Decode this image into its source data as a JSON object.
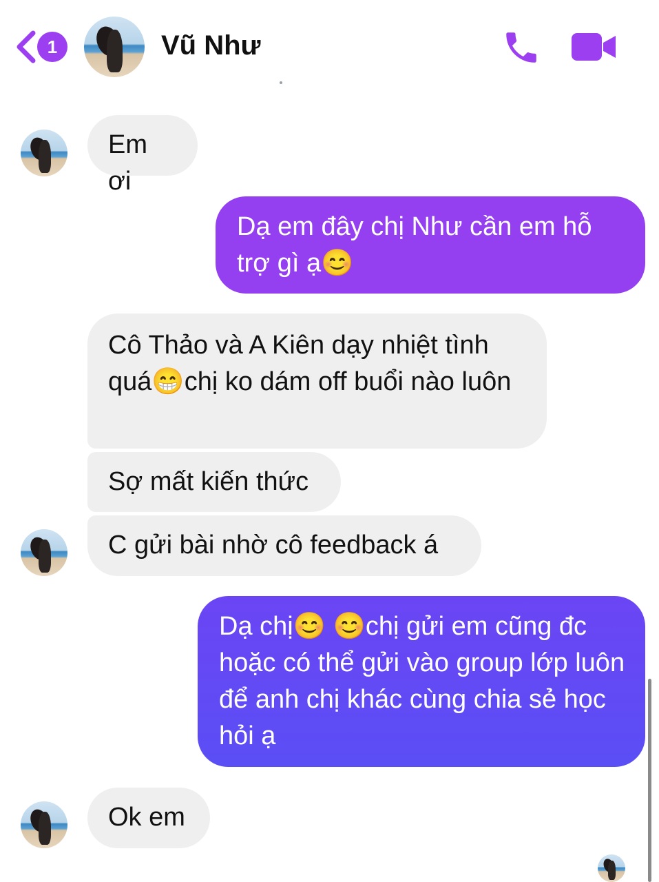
{
  "header": {
    "back_icon": "chevron-left-icon",
    "unread_count": "1",
    "contact_name": "Vũ Như",
    "call_icon": "phone-icon",
    "video_icon": "video-camera-icon",
    "accent_color": "#9b3ff0"
  },
  "messages": [
    {
      "sender": "contact",
      "text": "Em ơi"
    },
    {
      "sender": "me",
      "text": "Dạ em đây chị Như cần em hỗ trợ gì ạ😊"
    },
    {
      "sender": "contact",
      "text": "Cô Thảo và A Kiên dạy nhiệt tình quá😁chị ko dám off buổi nào luôn"
    },
    {
      "sender": "contact",
      "text": "Sợ mất kiến thức"
    },
    {
      "sender": "contact",
      "text": "C gửi bài nhờ cô feedback á"
    },
    {
      "sender": "me",
      "text": "Dạ chị😊 😊chị gửi em cũng đc hoặc có thể gửi vào group lớp luôn để anh chị khác cùng chia sẻ học hỏi ạ"
    },
    {
      "sender": "contact",
      "text": "Ok em"
    }
  ],
  "colors": {
    "incoming_bubble": "#efefef",
    "outgoing_purple": "#9b3ff0",
    "outgoing_blue": "#5b4bf5"
  }
}
